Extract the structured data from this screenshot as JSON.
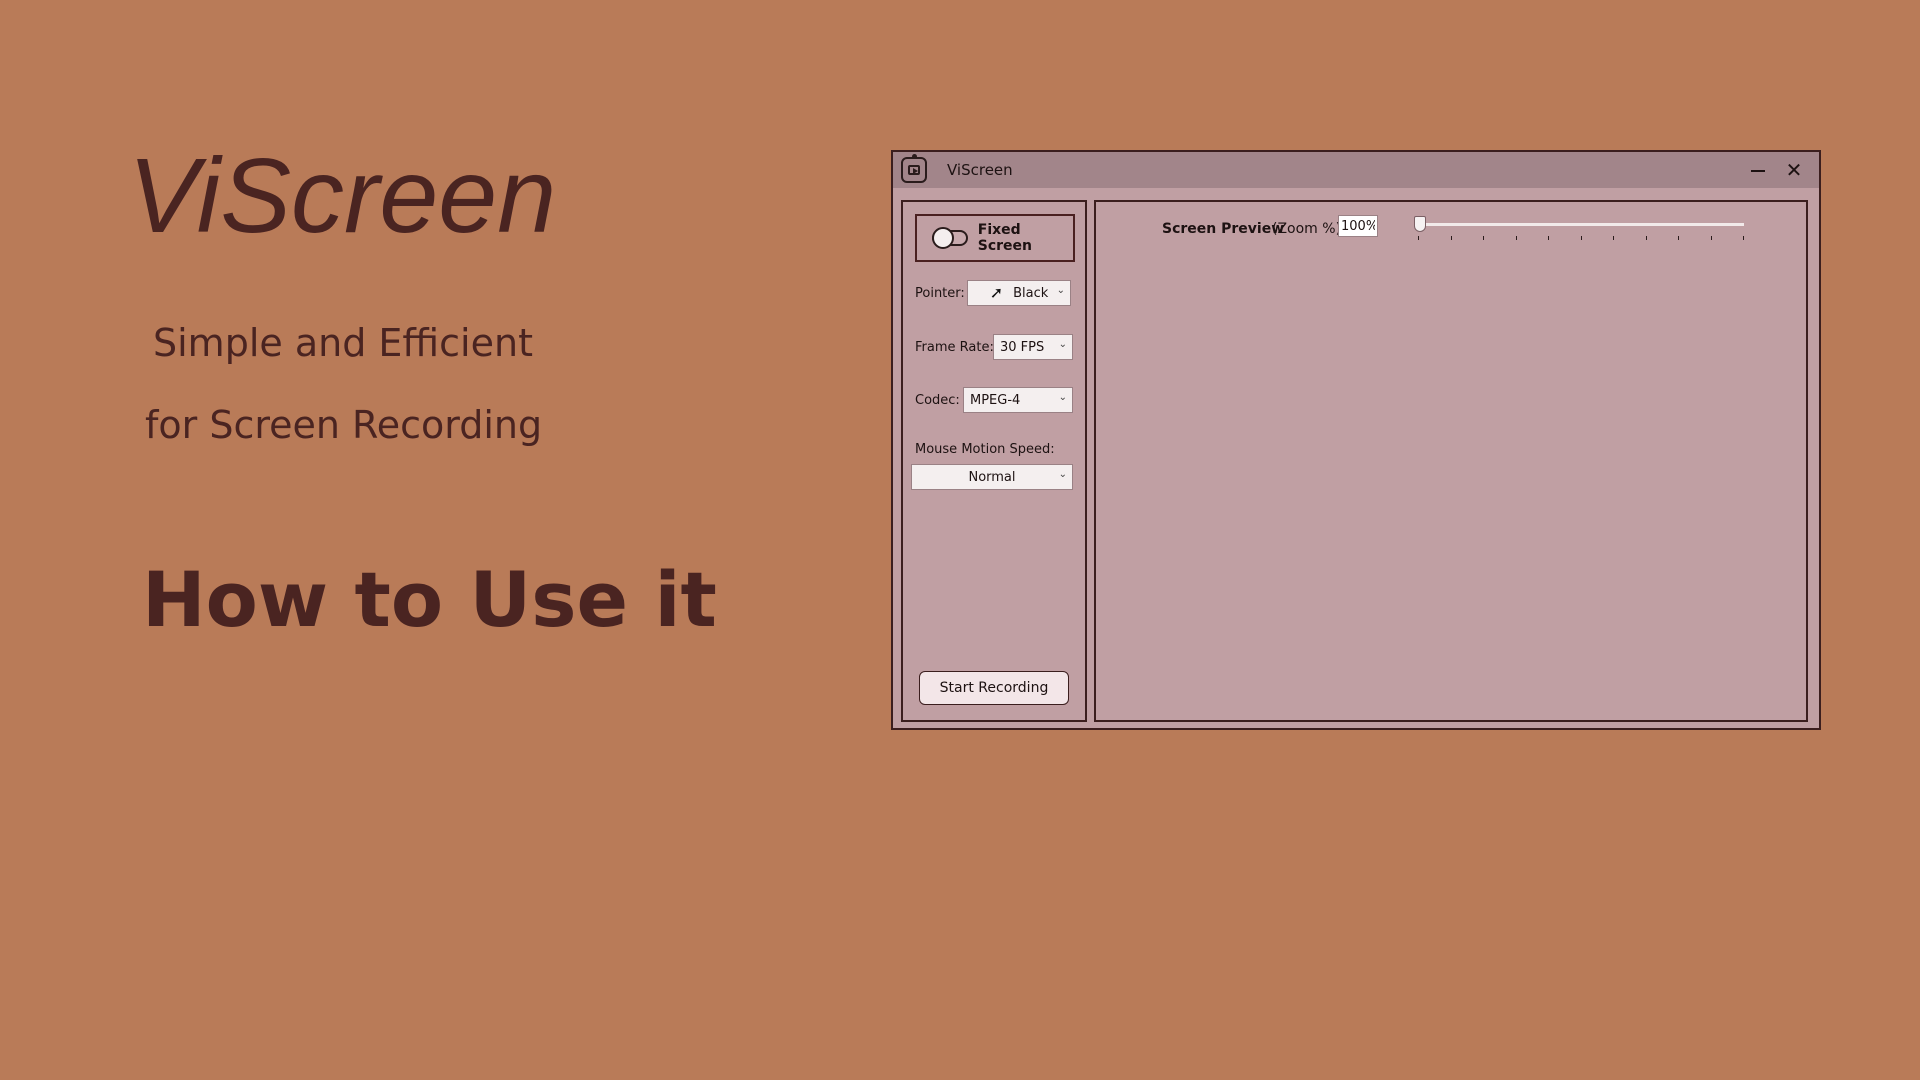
{
  "promo": {
    "title": "ViScreen",
    "tagline_line1": "Simple and Efficient",
    "tagline_line2": "for Screen Recording",
    "heading": "How to Use it"
  },
  "window": {
    "title": "ViScreen",
    "minimize_icon": "minimize-icon",
    "close_icon": "close-icon",
    "close_glyph": "✕"
  },
  "left_panel": {
    "fixed_screen_label": "Fixed Screen",
    "fixed_screen_on": false,
    "pointer_label": "Pointer:",
    "pointer_value": "Black",
    "pointer_icon_glyph": "➚",
    "frame_rate_label": "Frame Rate:",
    "frame_rate_value": "30 FPS",
    "codec_label": "Codec:",
    "codec_value": "MPEG-4",
    "mouse_speed_label": "Mouse Motion Speed:",
    "mouse_speed_value": "Normal",
    "chevron_glyph": "⌄",
    "start_button_label": "Start Recording"
  },
  "preview": {
    "label": "Screen Preview",
    "zoom_label": "(Zoom %)",
    "zoom_value": "100%",
    "zoom_slider_fraction": 0.0,
    "tick_count": 11
  },
  "colors": {
    "background": "#b97b58",
    "promo_text": "#4a2421",
    "window_body": "#c09fa3",
    "titlebar": "#a2858a",
    "border": "#3b1e1e"
  }
}
